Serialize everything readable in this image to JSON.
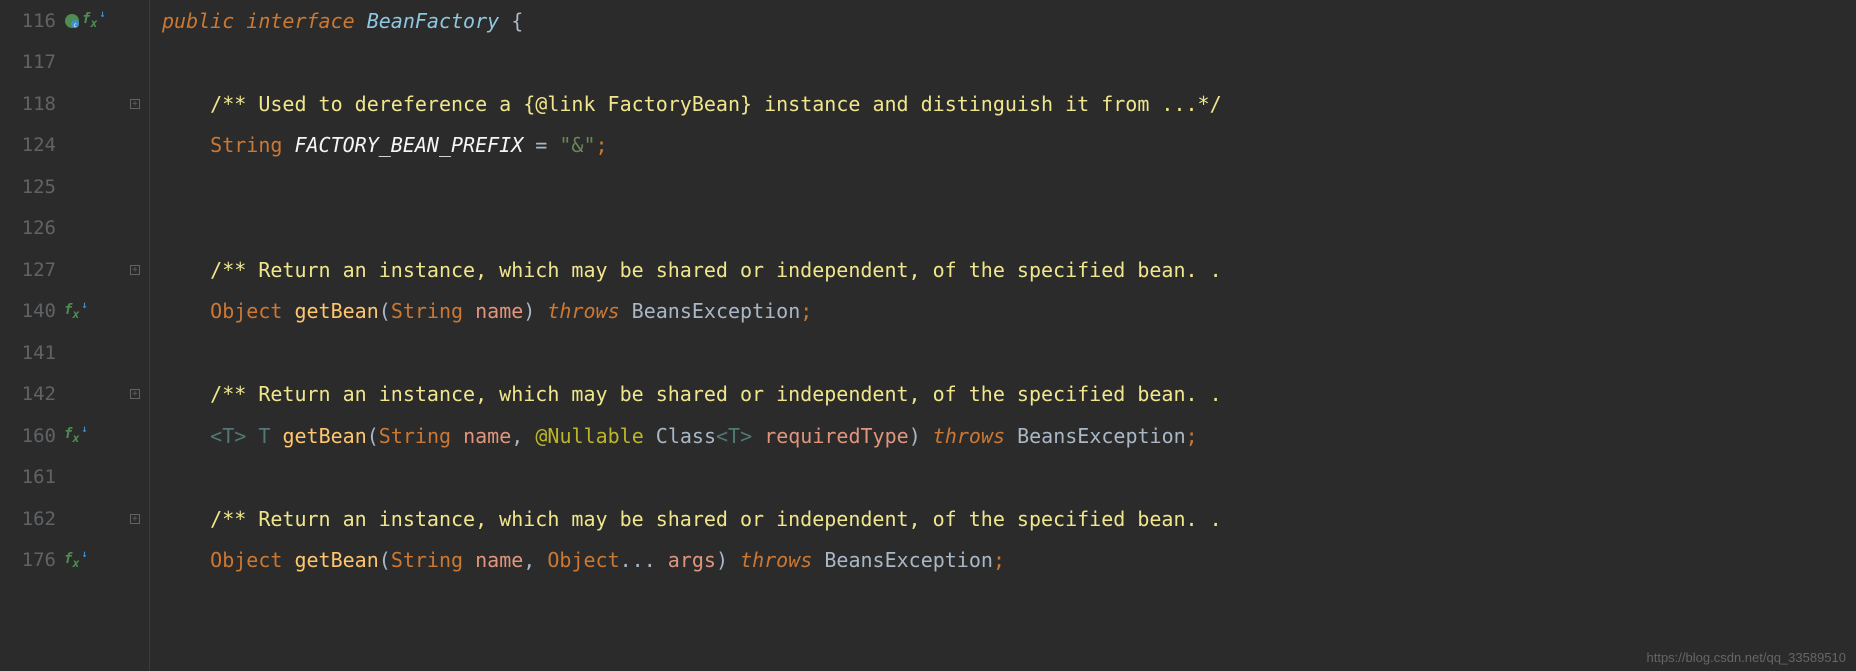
{
  "watermark": "https://blog.csdn.net/qq_33589510",
  "lines": {
    "l116": "116",
    "l117": "117",
    "l118": "118",
    "l124": "124",
    "l125": "125",
    "l126": "126",
    "l127": "127",
    "l140": "140",
    "l141": "141",
    "l142": "142",
    "l160": "160",
    "l161": "161",
    "l162": "162",
    "l176": "176"
  },
  "code": {
    "public": "public",
    "interface": "interface",
    "BeanFactory": "BeanFactory",
    "lbrace": " {",
    "c118_a": "/** Used to dereference a ",
    "c118_tag": "{@link FactoryBean}",
    "c118_b": " instance and distinguish it from ...*/",
    "String": "String",
    "FACTORY_BEAN_PREFIX": "FACTORY_BEAN_PREFIX",
    "eq": " = ",
    "amp": "\"&\"",
    "semi": ";",
    "c127": "/** Return an instance, which may be shared or independent, of the specified bean. .",
    "Object": "Object",
    "getBean": "getBean",
    "name": "name",
    "throws": "throws",
    "BeansException": "BeansException",
    "c142": "/** Return an instance, which may be shared or independent, of the specified bean. .",
    "T": "T",
    "Nullable": "@Nullable",
    "Class": "Class",
    "requiredType": "requiredType",
    "c162": "/** Return an instance, which may be shared or independent, of the specified bean. .",
    "args": "args",
    "dots": "...",
    "lt": "<",
    "gt": ">",
    "lp": "(",
    "rp": ")",
    "comma": ", ",
    "sp": " "
  }
}
